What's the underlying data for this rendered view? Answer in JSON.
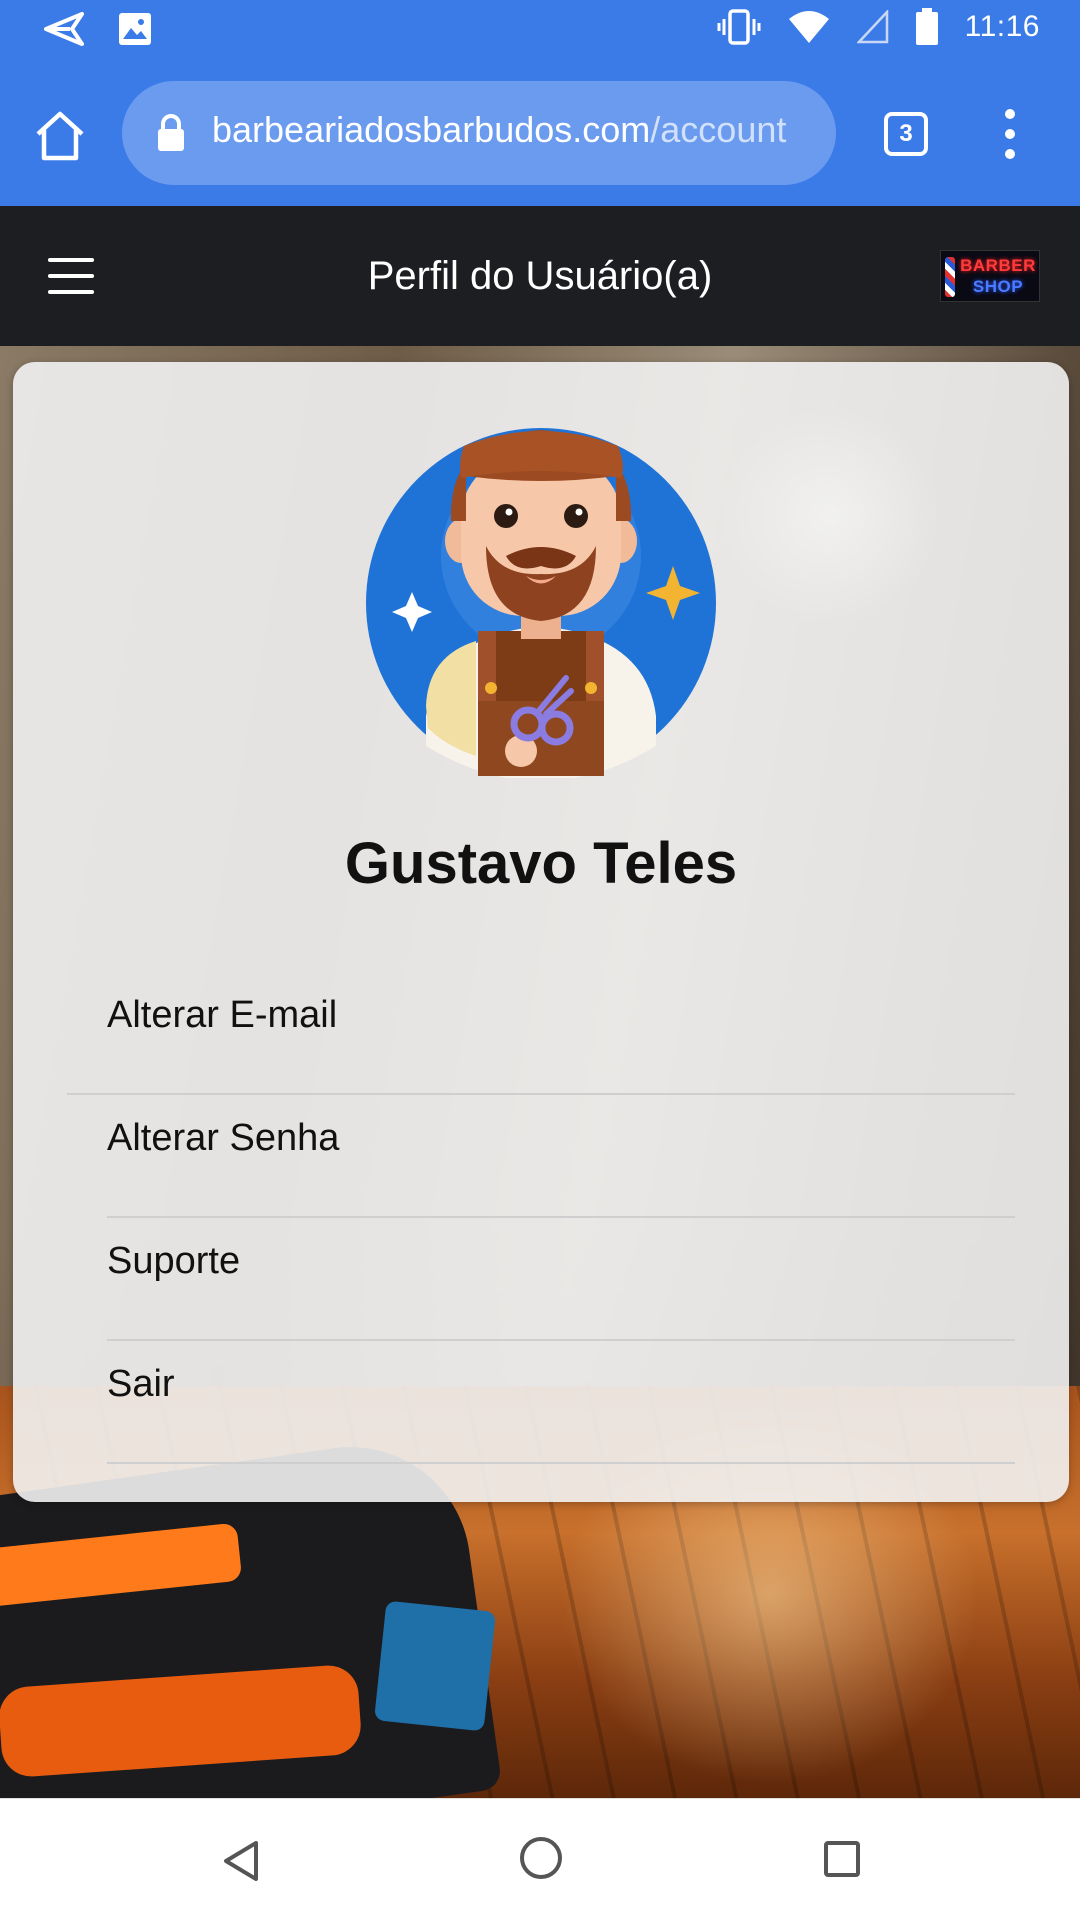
{
  "status_bar": {
    "time": "11:16",
    "left_icons": [
      "send-icon",
      "image-icon"
    ],
    "right_icons": [
      "vibrate-icon",
      "wifi-icon",
      "signal-icon",
      "battery-icon"
    ]
  },
  "browser": {
    "url_domain": "barbeariadosbarbudos.com",
    "url_path": "/account",
    "tab_count": "3"
  },
  "header": {
    "title": "Perfil do Usuário(a)",
    "logo_line1": "BARBER",
    "logo_line2": "SHOP"
  },
  "profile": {
    "name": "Gustavo Teles",
    "avatar": "barber-avatar"
  },
  "menu": {
    "items": [
      {
        "label": "Alterar E-mail"
      },
      {
        "label": "Alterar Senha"
      },
      {
        "label": "Suporte"
      },
      {
        "label": "Sair"
      }
    ]
  },
  "colors": {
    "chrome_blue": "#3b7be8",
    "header_dark": "#1d1e21",
    "card_bg": "#f2f2f2"
  }
}
